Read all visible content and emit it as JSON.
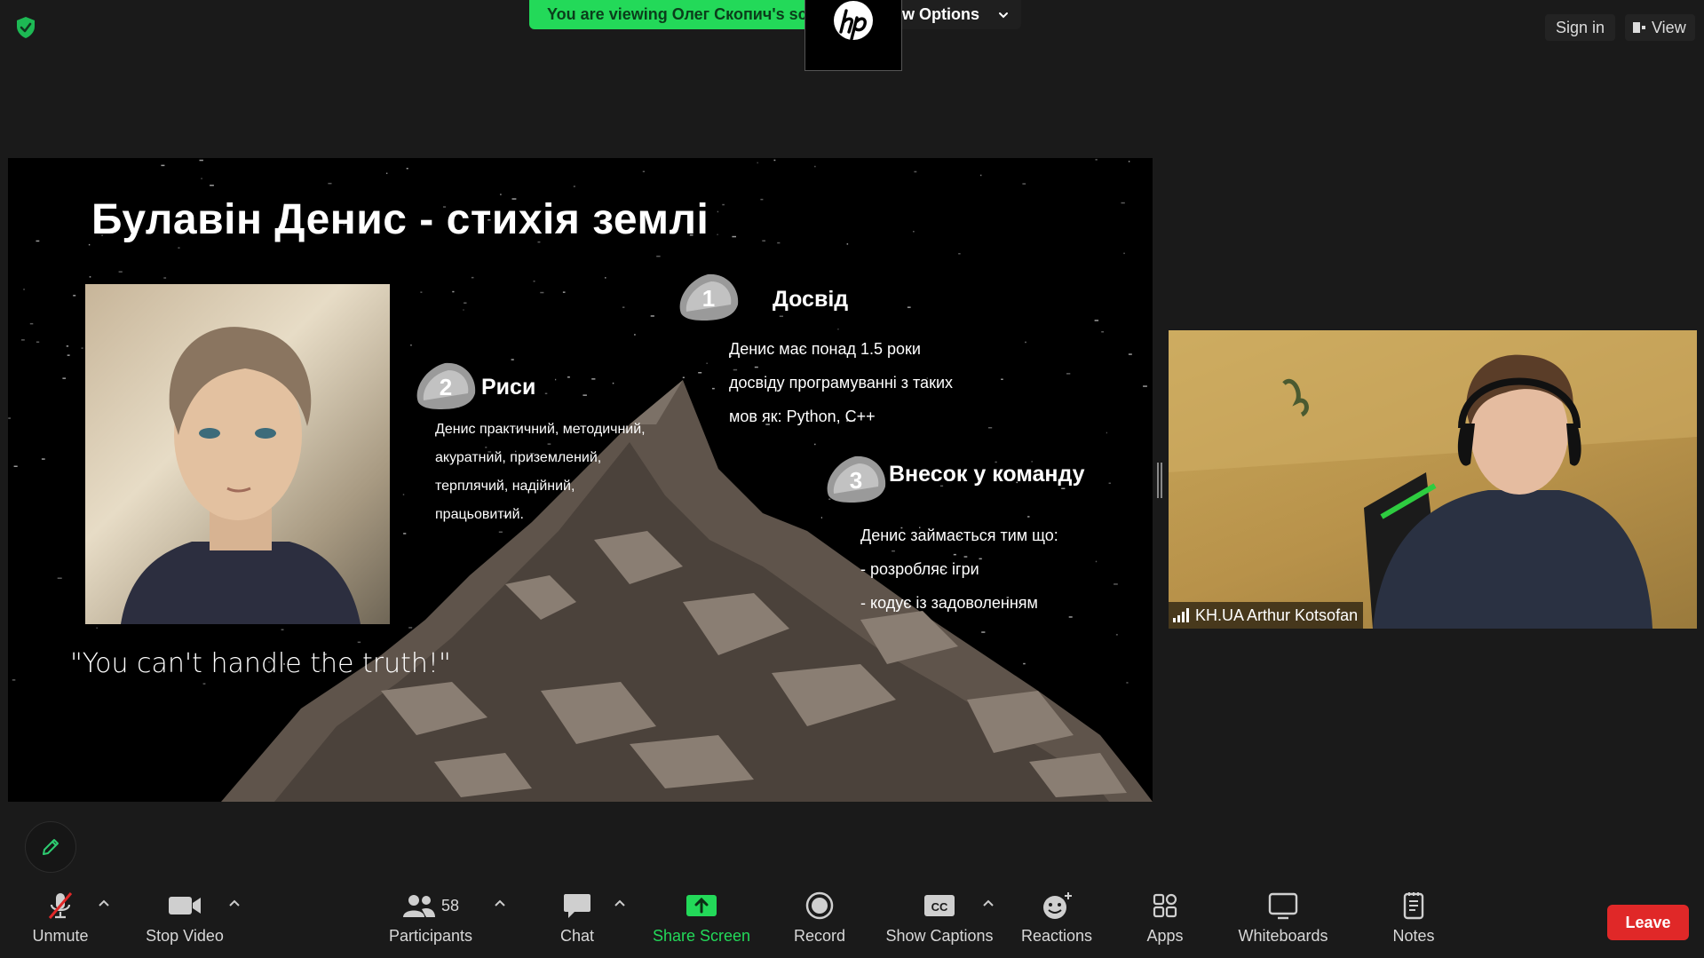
{
  "top_bar": {
    "banner_text": "You are viewing Олег Скопич's sc",
    "options_label": "w Options",
    "sign_in_label": "Sign in",
    "view_label": "View"
  },
  "slide": {
    "title": "Булавін Денис - стихія землі",
    "quote": "\"You can't handle the truth!\"",
    "sections": [
      {
        "number": "1",
        "title": "Досвід",
        "lines": [
          "Денис має понад 1.5 роки",
          "досвіду програмуванні з таких",
          "мов як: Python, C++"
        ]
      },
      {
        "number": "2",
        "title": "Риси",
        "lines": [
          "Денис практичний, методичний,",
          "акуратний, приземлений,",
          "терплячий, надійний,",
          " працьовитий."
        ]
      },
      {
        "number": "3",
        "title": "Внесок у команду",
        "lines": [
          "Денис займається тим що:",
          "- розробляє ігри",
          "- кодує із задоволенням"
        ]
      }
    ]
  },
  "participant_video": {
    "name": "KH.UA Arthur Kotsofan"
  },
  "toolbar": {
    "unmute": "Unmute",
    "stop_video": "Stop Video",
    "participants": "Participants",
    "participants_count": "58",
    "chat": "Chat",
    "share_screen": "Share Screen",
    "record": "Record",
    "show_captions": "Show Captions",
    "reactions": "Reactions",
    "apps": "Apps",
    "whiteboards": "Whiteboards",
    "notes": "Notes",
    "leave": "Leave"
  },
  "colors": {
    "share_green": "#23d959",
    "leave_red": "#e02828",
    "toolbar_bg": "#1a1a1a"
  }
}
